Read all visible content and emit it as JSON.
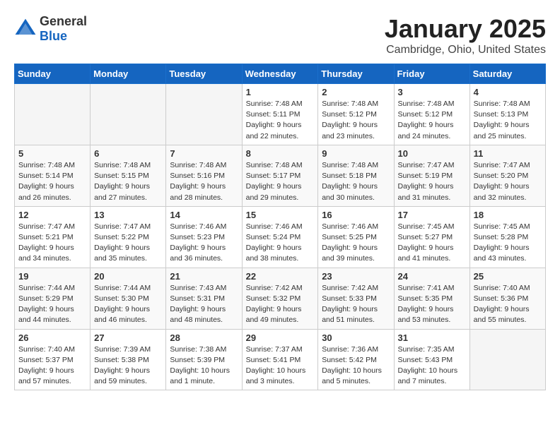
{
  "logo": {
    "general": "General",
    "blue": "Blue"
  },
  "title": "January 2025",
  "location": "Cambridge, Ohio, United States",
  "days_of_week": [
    "Sunday",
    "Monday",
    "Tuesday",
    "Wednesday",
    "Thursday",
    "Friday",
    "Saturday"
  ],
  "weeks": [
    [
      {
        "day": "",
        "info": ""
      },
      {
        "day": "",
        "info": ""
      },
      {
        "day": "",
        "info": ""
      },
      {
        "day": "1",
        "info": "Sunrise: 7:48 AM\nSunset: 5:11 PM\nDaylight: 9 hours and 22 minutes."
      },
      {
        "day": "2",
        "info": "Sunrise: 7:48 AM\nSunset: 5:12 PM\nDaylight: 9 hours and 23 minutes."
      },
      {
        "day": "3",
        "info": "Sunrise: 7:48 AM\nSunset: 5:12 PM\nDaylight: 9 hours and 24 minutes."
      },
      {
        "day": "4",
        "info": "Sunrise: 7:48 AM\nSunset: 5:13 PM\nDaylight: 9 hours and 25 minutes."
      }
    ],
    [
      {
        "day": "5",
        "info": "Sunrise: 7:48 AM\nSunset: 5:14 PM\nDaylight: 9 hours and 26 minutes."
      },
      {
        "day": "6",
        "info": "Sunrise: 7:48 AM\nSunset: 5:15 PM\nDaylight: 9 hours and 27 minutes."
      },
      {
        "day": "7",
        "info": "Sunrise: 7:48 AM\nSunset: 5:16 PM\nDaylight: 9 hours and 28 minutes."
      },
      {
        "day": "8",
        "info": "Sunrise: 7:48 AM\nSunset: 5:17 PM\nDaylight: 9 hours and 29 minutes."
      },
      {
        "day": "9",
        "info": "Sunrise: 7:48 AM\nSunset: 5:18 PM\nDaylight: 9 hours and 30 minutes."
      },
      {
        "day": "10",
        "info": "Sunrise: 7:47 AM\nSunset: 5:19 PM\nDaylight: 9 hours and 31 minutes."
      },
      {
        "day": "11",
        "info": "Sunrise: 7:47 AM\nSunset: 5:20 PM\nDaylight: 9 hours and 32 minutes."
      }
    ],
    [
      {
        "day": "12",
        "info": "Sunrise: 7:47 AM\nSunset: 5:21 PM\nDaylight: 9 hours and 34 minutes."
      },
      {
        "day": "13",
        "info": "Sunrise: 7:47 AM\nSunset: 5:22 PM\nDaylight: 9 hours and 35 minutes."
      },
      {
        "day": "14",
        "info": "Sunrise: 7:46 AM\nSunset: 5:23 PM\nDaylight: 9 hours and 36 minutes."
      },
      {
        "day": "15",
        "info": "Sunrise: 7:46 AM\nSunset: 5:24 PM\nDaylight: 9 hours and 38 minutes."
      },
      {
        "day": "16",
        "info": "Sunrise: 7:46 AM\nSunset: 5:25 PM\nDaylight: 9 hours and 39 minutes."
      },
      {
        "day": "17",
        "info": "Sunrise: 7:45 AM\nSunset: 5:27 PM\nDaylight: 9 hours and 41 minutes."
      },
      {
        "day": "18",
        "info": "Sunrise: 7:45 AM\nSunset: 5:28 PM\nDaylight: 9 hours and 43 minutes."
      }
    ],
    [
      {
        "day": "19",
        "info": "Sunrise: 7:44 AM\nSunset: 5:29 PM\nDaylight: 9 hours and 44 minutes."
      },
      {
        "day": "20",
        "info": "Sunrise: 7:44 AM\nSunset: 5:30 PM\nDaylight: 9 hours and 46 minutes."
      },
      {
        "day": "21",
        "info": "Sunrise: 7:43 AM\nSunset: 5:31 PM\nDaylight: 9 hours and 48 minutes."
      },
      {
        "day": "22",
        "info": "Sunrise: 7:42 AM\nSunset: 5:32 PM\nDaylight: 9 hours and 49 minutes."
      },
      {
        "day": "23",
        "info": "Sunrise: 7:42 AM\nSunset: 5:33 PM\nDaylight: 9 hours and 51 minutes."
      },
      {
        "day": "24",
        "info": "Sunrise: 7:41 AM\nSunset: 5:35 PM\nDaylight: 9 hours and 53 minutes."
      },
      {
        "day": "25",
        "info": "Sunrise: 7:40 AM\nSunset: 5:36 PM\nDaylight: 9 hours and 55 minutes."
      }
    ],
    [
      {
        "day": "26",
        "info": "Sunrise: 7:40 AM\nSunset: 5:37 PM\nDaylight: 9 hours and 57 minutes."
      },
      {
        "day": "27",
        "info": "Sunrise: 7:39 AM\nSunset: 5:38 PM\nDaylight: 9 hours and 59 minutes."
      },
      {
        "day": "28",
        "info": "Sunrise: 7:38 AM\nSunset: 5:39 PM\nDaylight: 10 hours and 1 minute."
      },
      {
        "day": "29",
        "info": "Sunrise: 7:37 AM\nSunset: 5:41 PM\nDaylight: 10 hours and 3 minutes."
      },
      {
        "day": "30",
        "info": "Sunrise: 7:36 AM\nSunset: 5:42 PM\nDaylight: 10 hours and 5 minutes."
      },
      {
        "day": "31",
        "info": "Sunrise: 7:35 AM\nSunset: 5:43 PM\nDaylight: 10 hours and 7 minutes."
      },
      {
        "day": "",
        "info": ""
      }
    ]
  ]
}
